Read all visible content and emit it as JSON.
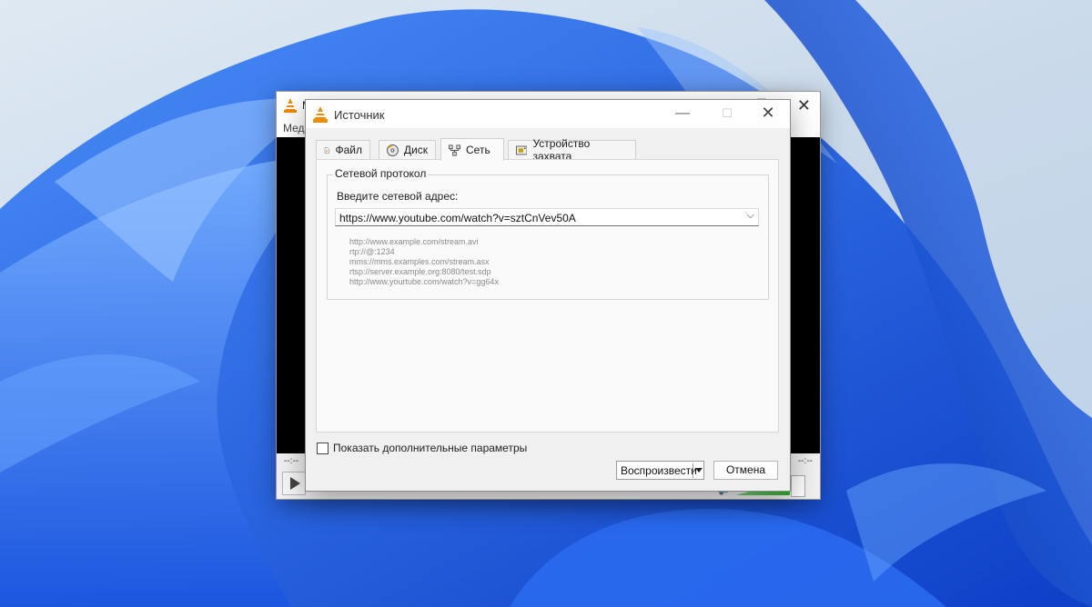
{
  "background_window": {
    "title": "М",
    "menu": "Меди",
    "time_left": "--:--",
    "time_right": "--:--"
  },
  "dialog": {
    "title": "Источник",
    "tabs": [
      {
        "label": "Файл",
        "icon": "file-icon"
      },
      {
        "label": "Диск",
        "icon": "disc-icon"
      },
      {
        "label": "Сеть",
        "icon": "network-icon",
        "active": true
      },
      {
        "label": "Устройство захвата",
        "icon": "capture-device-icon"
      }
    ],
    "group_title": "Сетевой протокол",
    "address_label": "Введите сетевой адрес:",
    "address_value": "https://www.youtube.com/watch?v=sztCnVev50A",
    "examples": [
      "http://www.example.com/stream.avi",
      "rtp://@:1234",
      "mms://mms.examples.com/stream.asx",
      "rtsp://server.example.org:8080/test.sdp",
      "http://www.yourtube.com/watch?v=gg64x"
    ],
    "show_more_label": "Показать дополнительные параметры",
    "show_more_checked": false,
    "play_button": "Воспроизвести",
    "cancel_button": "Отмена"
  },
  "colors": {
    "wallpaper_blue": "#1e63e6",
    "accent_orange": "#f08a00",
    "video_black": "#000000"
  }
}
